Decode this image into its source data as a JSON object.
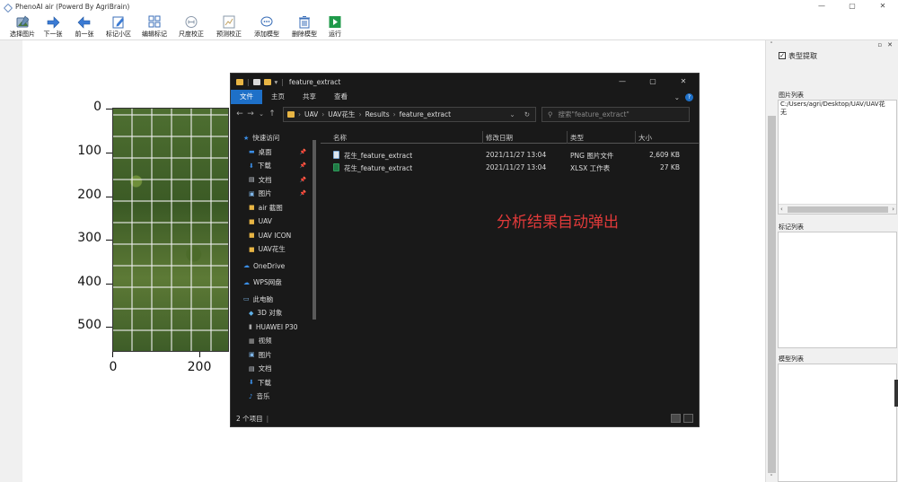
{
  "window": {
    "title": "PhenoAI air (Powerd By AgriBrain)",
    "controls": [
      "—",
      "▢",
      "✕"
    ]
  },
  "toolbar": {
    "items": [
      {
        "label": "选择图片",
        "icon": "image-icon"
      },
      {
        "label": "下一张",
        "icon": "arrow-right-icon"
      },
      {
        "label": "前一张",
        "icon": "arrow-left-icon"
      },
      {
        "label": "标记小区",
        "icon": "edit-icon"
      },
      {
        "label": "编辑标记",
        "icon": "grid-icon"
      },
      {
        "label": "尺度校正",
        "icon": "scale-icon"
      },
      {
        "label": "预测校正",
        "icon": "chart-icon"
      },
      {
        "label": "添加模型",
        "icon": "chat-icon"
      },
      {
        "label": "删除模型",
        "icon": "trash-icon"
      },
      {
        "label": "运行",
        "icon": "play-icon"
      }
    ]
  },
  "plot": {
    "yticks": [
      "0",
      "100",
      "200",
      "300",
      "400",
      "500"
    ],
    "xticks": [
      "0",
      "200"
    ]
  },
  "explorer": {
    "title": "feature_extract",
    "ribbon_tabs": [
      "文件",
      "主页",
      "共享",
      "查看"
    ],
    "breadcrumb": [
      "UAV",
      "UAV花生",
      "Results",
      "feature_extract"
    ],
    "search_placeholder": "搜索\"feature_extract\"",
    "nav_items": [
      {
        "label": "快速访问",
        "level": "top",
        "icon": "star-icon",
        "pin": false
      },
      {
        "label": "桌面",
        "level": "sub",
        "icon": "desktop-icon",
        "pin": true
      },
      {
        "label": "下载",
        "level": "sub",
        "icon": "download-icon",
        "pin": true
      },
      {
        "label": "文档",
        "level": "sub",
        "icon": "document-icon",
        "pin": true
      },
      {
        "label": "图片",
        "level": "sub",
        "icon": "picture-icon",
        "pin": true
      },
      {
        "label": "air 截图",
        "level": "sub",
        "icon": "folder-icon",
        "pin": false
      },
      {
        "label": "UAV",
        "level": "sub",
        "icon": "folder-icon",
        "pin": false
      },
      {
        "label": "UAV ICON",
        "level": "sub",
        "icon": "folder-icon",
        "pin": false
      },
      {
        "label": "UAV花生",
        "level": "sub",
        "icon": "folder-icon",
        "pin": false
      },
      {
        "label": "OneDrive",
        "level": "top",
        "icon": "cloud-icon",
        "pin": false
      },
      {
        "label": "WPS网盘",
        "level": "top",
        "icon": "cloud-icon",
        "pin": false
      },
      {
        "label": "此电脑",
        "level": "top",
        "icon": "computer-icon",
        "pin": false
      },
      {
        "label": "3D 对象",
        "level": "sub",
        "icon": "cube-icon",
        "pin": false
      },
      {
        "label": "HUAWEI P30",
        "level": "sub",
        "icon": "phone-icon",
        "pin": false
      },
      {
        "label": "视频",
        "level": "sub",
        "icon": "video-icon",
        "pin": false
      },
      {
        "label": "图片",
        "level": "sub",
        "icon": "picture-icon",
        "pin": false
      },
      {
        "label": "文档",
        "level": "sub",
        "icon": "document-icon",
        "pin": false
      },
      {
        "label": "下载",
        "level": "sub",
        "icon": "download-icon",
        "pin": false
      },
      {
        "label": "音乐",
        "level": "sub",
        "icon": "music-icon",
        "pin": false
      }
    ],
    "columns": [
      "名称",
      "修改日期",
      "类型",
      "大小"
    ],
    "files": [
      {
        "name": "花生_feature_extract",
        "date": "2021/11/27 13:04",
        "type": "PNG 图片文件",
        "size": "2,609 KB",
        "kind": "png"
      },
      {
        "name": "花生_feature_extract",
        "date": "2021/11/27 13:04",
        "type": "XLSX 工作表",
        "size": "27 KB",
        "kind": "xlsx"
      }
    ],
    "status": "2 个项目",
    "overlay_note": "分析结果自动弹出"
  },
  "right_panel": {
    "checkbox_label": "表型提取",
    "image_list_label": "图片列表",
    "image_list_items": [
      "C:/Users/agri/Desktop/UAV/UAV花",
      "无"
    ],
    "mark_list_label": "标记列表",
    "model_list_label": "模型列表"
  },
  "colors": {
    "accent": "#1e70c8",
    "note": "#e23a3a",
    "explorer_bg": "#191919"
  }
}
